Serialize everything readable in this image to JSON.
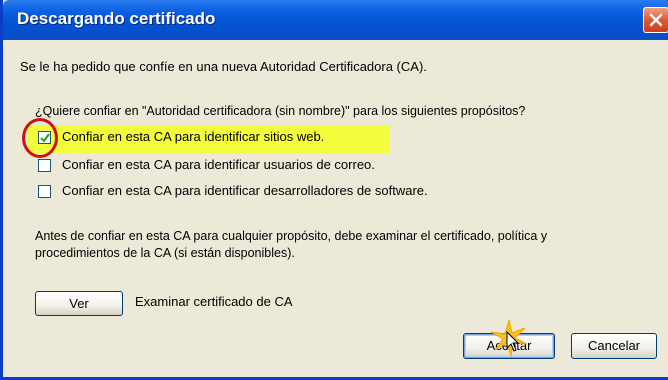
{
  "window": {
    "title": "Descargando certificado"
  },
  "dialog": {
    "intro": "Se le ha pedido que confíe en una nueva Autoridad Certificadora (CA).",
    "question": "¿Quiere confiar en \"Autoridad certificadora (sin nombre)\" para los siguientes propósitos?",
    "options": [
      {
        "label": "Confiar en esta CA para identificar sitios web.",
        "checked": true
      },
      {
        "label": "Confiar en esta CA para identificar usuarios de correo.",
        "checked": false
      },
      {
        "label": "Confiar en esta CA para identificar desarrolladores de software.",
        "checked": false
      }
    ],
    "advice_line1": "Antes de confiar en esta CA para cualquier propósito, debe examinar el certificado, política y",
    "advice_line2": "procedimientos de la CA (si están disponibles).",
    "view_button": "Ver",
    "view_caption": "Examinar certificado de CA",
    "accept_button": "Aceptar",
    "cancel_button": "Cancelar"
  },
  "colors": {
    "titlebar": "#0453d4",
    "highlight": "#f4ff2a",
    "annotation_circle": "#d01010",
    "background": "#ece9d8"
  },
  "icons": [
    "close-icon",
    "checkmark-icon",
    "sparkle-cursor-icon"
  ]
}
